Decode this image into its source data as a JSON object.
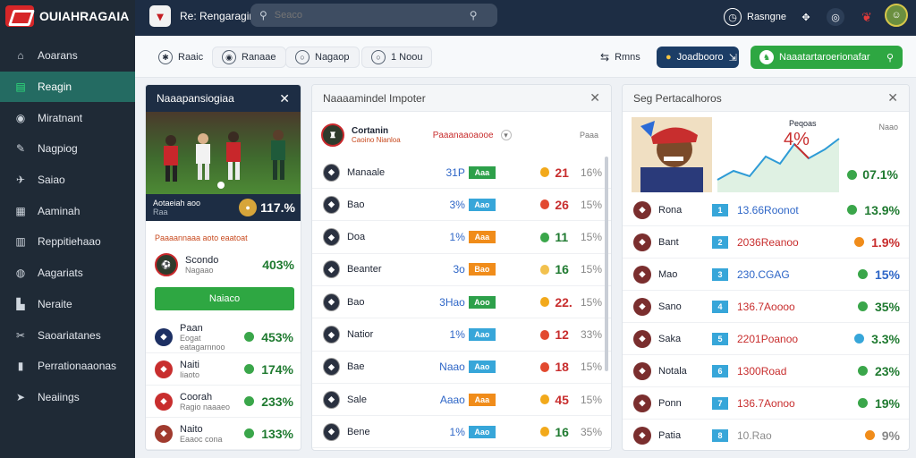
{
  "app": {
    "title": "OUIAHRAGAIA"
  },
  "sidebar": {
    "items": [
      {
        "label": "Aoarans",
        "icon": "home-icon"
      },
      {
        "label": "Reagin",
        "icon": "chart-icon"
      },
      {
        "label": "Miratnant",
        "icon": "camera-icon"
      },
      {
        "label": "Nagpiog",
        "icon": "chat-icon"
      },
      {
        "label": "Saiao",
        "icon": "plane-icon"
      },
      {
        "label": "Aaminah",
        "icon": "calendar-icon"
      },
      {
        "label": "Reppitiehaao",
        "icon": "report-icon"
      },
      {
        "label": "Aagariats",
        "icon": "bag-icon"
      },
      {
        "label": "Neraite",
        "icon": "building-icon"
      },
      {
        "label": "Saoariatanes",
        "icon": "tools-icon"
      },
      {
        "label": "Perrationaaonas",
        "icon": "chart-bar-icon"
      },
      {
        "label": "Neaiings",
        "icon": "send-icon"
      }
    ],
    "active": 1
  },
  "topbar": {
    "title": "Re: Rengaragin",
    "search_placeholder": "Seaco",
    "user_label": "Rasngne"
  },
  "filters": {
    "items": [
      "Raaic",
      "Ranaae",
      "Nagaop",
      "1 Noou",
      "Rmns",
      "Joadbooro",
      "Naaatartaroerionafar"
    ]
  },
  "panel1": {
    "title": "Naaapansiogiaa",
    "hero_text": "Aotaeiah aoo",
    "hero_sub": "Raa",
    "hero_pct": "117.%",
    "sub_line": "Paaaannaaa aoto eaatoat",
    "featured_name": "Scondo",
    "featured_sub": "Nagaao",
    "featured_pct": "403%",
    "cta": "Naiaco",
    "rows": [
      {
        "name": "Paan",
        "sub": "Eogat eatagarnnoo",
        "pct": "453%",
        "color": "#1c2f63"
      },
      {
        "name": "Naiti",
        "sub": "Iiaoto",
        "pct": "174%",
        "color": "#c82e2e"
      },
      {
        "name": "Coorah",
        "sub": "Ragio naaaeo",
        "pct": "233%",
        "color": "#c82e2e"
      },
      {
        "name": "Naito",
        "sub": "Eaaoc cona",
        "pct": "133%",
        "color": "#a03a2e"
      }
    ]
  },
  "panel2": {
    "title": "Naaaamindel Impoter",
    "head_name": "Cortanin",
    "head_sub": "Caoino Nianloa",
    "head_label": "Paaanaaoaooe",
    "head_right": "Paaa",
    "rows": [
      {
        "name": "Manaale",
        "pct": "31P",
        "bar": "Aaa",
        "bar_color": "#2da04a",
        "num": "21",
        "perc": "16%",
        "dot": "#f2a91b",
        "num_color": "#c82e2e"
      },
      {
        "name": "Bao",
        "pct": "3%",
        "bar": "Aao",
        "bar_color": "#37a6d9",
        "num": "26",
        "perc": "15%",
        "dot": "#e2492f",
        "num_color": "#c82e2e"
      },
      {
        "name": "Doa",
        "pct": "1%",
        "bar": "Aaa",
        "bar_color": "#f08c1a",
        "num": "11",
        "perc": "15%",
        "dot": "#3aa64a",
        "num_color": "#1f7a30"
      },
      {
        "name": "Beanter",
        "pct": "3o",
        "bar": "Bao",
        "bar_color": "#f08c1a",
        "num": "16",
        "perc": "15%",
        "dot": "#f2c14e",
        "num_color": "#1f7a30"
      },
      {
        "name": "Bao",
        "pct": "3Hao",
        "bar": "Aoo",
        "bar_color": "#2da04a",
        "num": "22.",
        "perc": "15%",
        "dot": "#f2a91b",
        "num_color": "#c82e2e"
      },
      {
        "name": "Natior",
        "pct": "1%",
        "bar": "Aao",
        "bar_color": "#37a6d9",
        "num": "12",
        "perc": "33%",
        "dot": "#e2492f",
        "num_color": "#c82e2e"
      },
      {
        "name": "Bae",
        "pct": "Naao",
        "bar": "Aao",
        "bar_color": "#37a6d9",
        "num": "18",
        "perc": "15%",
        "dot": "#e2492f",
        "num_color": "#c82e2e"
      },
      {
        "name": "Sale",
        "pct": "Aaao",
        "bar": "Aaa",
        "bar_color": "#f08c1a",
        "num": "45",
        "perc": "15%",
        "dot": "#f2a91b",
        "num_color": "#c82e2e"
      },
      {
        "name": "Bene",
        "pct": "1%",
        "bar": "Aao",
        "bar_color": "#37a6d9",
        "num": "16",
        "perc": "35%",
        "dot": "#f2a91b",
        "num_color": "#1f7a30"
      }
    ]
  },
  "panel3": {
    "title": "Seg Pertacalhoros",
    "chart_title": "Peqoas",
    "chart_value": "4%",
    "chart_right": "Naao",
    "top_pct": "07.1%",
    "rows": [
      {
        "name": "Rona",
        "val": "13.66Roonot",
        "val_color": "#2e66c7",
        "pct": "13.9%",
        "dot": "#3aa64a",
        "pct_color": "#1f7a30"
      },
      {
        "name": "Bant",
        "val": "2036Reanoo",
        "val_color": "#c82e2e",
        "pct": "1.9%",
        "dot": "#f08c1a",
        "pct_color": "#c82e2e"
      },
      {
        "name": "Mao",
        "val": "230.CGAG",
        "val_color": "#2e66c7",
        "pct": "15%",
        "dot": "#3aa64a",
        "pct_color": "#2e66c7"
      },
      {
        "name": "Sano",
        "val": "136.7Aoooo",
        "val_color": "#c82e2e",
        "pct": "35%",
        "dot": "#3aa64a",
        "pct_color": "#1f7a30"
      },
      {
        "name": "Saka",
        "val": "2201Poanoo",
        "val_color": "#c82e2e",
        "pct": "3.3%",
        "dot": "#37a6d9",
        "pct_color": "#1f7a30"
      },
      {
        "name": "Notala",
        "val": "1300Road",
        "val_color": "#c82e2e",
        "pct": "23%",
        "dot": "#3aa64a",
        "pct_color": "#1f7a30"
      },
      {
        "name": "Ponn",
        "val": "136.7Aonoo",
        "val_color": "#c82e2e",
        "pct": "19%",
        "dot": "#3aa64a",
        "pct_color": "#1f7a30"
      },
      {
        "name": "Patia",
        "val": "10.Rao",
        "val_color": "#8c8c8c",
        "pct": "9%",
        "dot": "#f08c1a",
        "pct_color": "#888"
      }
    ]
  }
}
